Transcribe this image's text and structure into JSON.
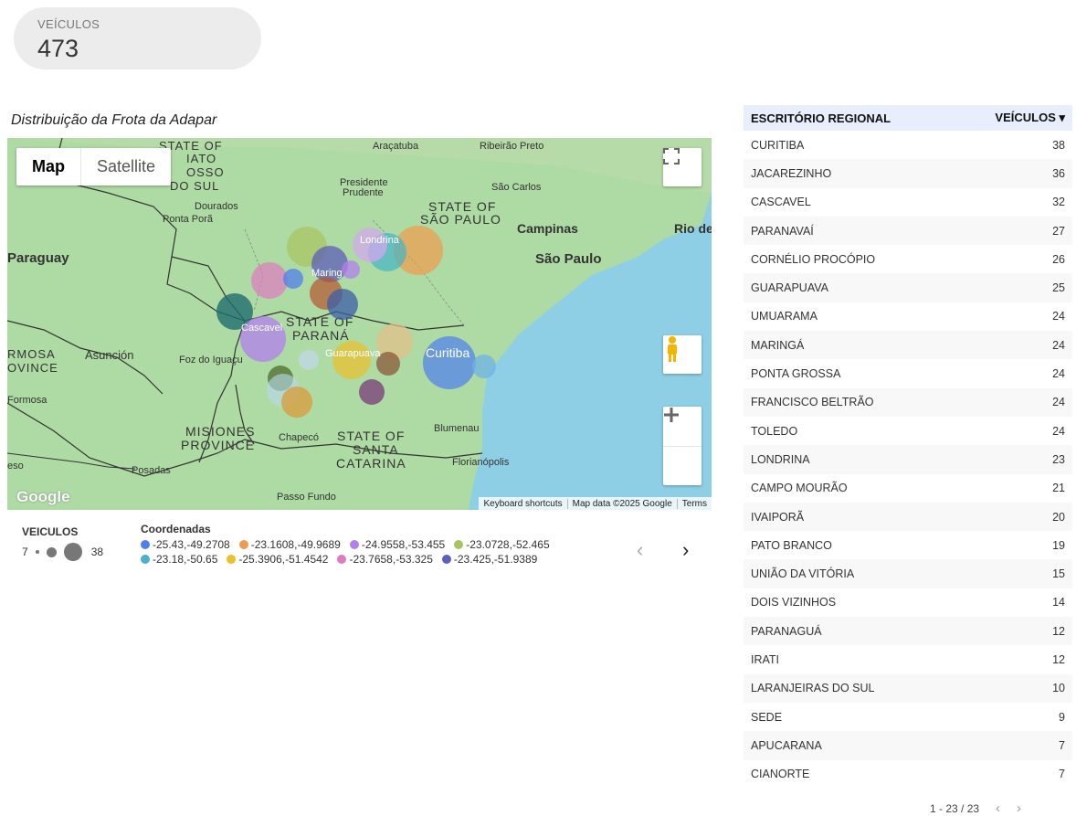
{
  "kpi": {
    "label": "VEÍCULOS",
    "value": "473"
  },
  "map": {
    "title": "Distribuição da Frota da Adapar",
    "map_btn": "Map",
    "satellite_btn": "Satellite",
    "attribution": {
      "shortcuts": "Keyboard shortcuts",
      "data": "Map data ©2025 Google",
      "terms": "Terms"
    },
    "google_logo": "Google",
    "places": {
      "paraguay": "Paraguay",
      "asuncion": "Asunción",
      "formosa": "Formosa",
      "formosa_prov_1": "RMOSA",
      "formosa_prov_2": "OVINCE",
      "ms_1": "STATE OF",
      "ms_2": "IATO",
      "ms_3": "OSSO",
      "ms_4": "DO SUL",
      "dourados": "Dourados",
      "ponta_pora": "Ponta Porã",
      "aracatuba": "Araçatuba",
      "ribeirao": "Ribeirão Preto",
      "pres_prudente_1": "Presidente",
      "pres_prudente_2": "Prudente",
      "sao_carlos": "São Carlos",
      "sp_1": "STATE OF",
      "sp_2": "SÃO PAULO",
      "campinas": "Campinas",
      "sao_paulo": "São Paulo",
      "rio": "Rio de",
      "londrina": "Londrina",
      "maringa": "Maring",
      "cascavel": "Cascavel",
      "guarapuava": "Guarapuava",
      "curitiba": "Curitiba",
      "pr_1": "STATE OF",
      "pr_2": "PARANÁ",
      "foz": "Foz do Iguaçu",
      "misiones_1": "MISIONES",
      "misiones_2": "PROVINCE",
      "posadas": "Posadas",
      "chapeco": "Chapecó",
      "sc_1": "STATE OF",
      "sc_2": "SANTA",
      "sc_3": "CATARINA",
      "blumenau": "Blumenau",
      "florianopolis": "Florianópolis",
      "passo_fundo": "Passo Fundo",
      "eso": "eso"
    }
  },
  "legend": {
    "size_title": "VEICULOS",
    "size_min": "7",
    "size_max": "38",
    "color_title": "Coordenadas",
    "items": [
      {
        "label": "-25.43,-49.2708",
        "color": "#4f7fee"
      },
      {
        "label": "-23.1608,-49.9689",
        "color": "#ef9b4b"
      },
      {
        "label": "-24.9558,-53.455",
        "color": "#b27fee"
      },
      {
        "label": "-23.0728,-52.465",
        "color": "#a8c55f"
      },
      {
        "label": "-23.18,-50.65",
        "color": "#46b3c8"
      },
      {
        "label": "-25.3906,-51.4542",
        "color": "#e8c030"
      },
      {
        "label": "-23.7658,-53.325",
        "color": "#e07bc0"
      },
      {
        "label": "-23.425,-51.9389",
        "color": "#5d5fb8"
      }
    ],
    "prev": "‹",
    "next": "›"
  },
  "table": {
    "col1": "ESCRITÓRIO REGIONAL",
    "col2": "VEÍCULOS ▾",
    "rows": [
      {
        "name": "CURITIBA",
        "value": "38"
      },
      {
        "name": "JACAREZINHO",
        "value": "36"
      },
      {
        "name": "CASCAVEL",
        "value": "32"
      },
      {
        "name": "PARANAVAÍ",
        "value": "27"
      },
      {
        "name": "CORNÉLIO PROCÓPIO",
        "value": "26"
      },
      {
        "name": "GUARAPUAVA",
        "value": "25"
      },
      {
        "name": "UMUARAMA",
        "value": "24"
      },
      {
        "name": "MARINGÁ",
        "value": "24"
      },
      {
        "name": "PONTA GROSSA",
        "value": "24"
      },
      {
        "name": "FRANCISCO BELTRÃO",
        "value": "24"
      },
      {
        "name": "TOLEDO",
        "value": "24"
      },
      {
        "name": "LONDRINA",
        "value": "23"
      },
      {
        "name": "CAMPO MOURÃO",
        "value": "21"
      },
      {
        "name": "IVAIPORÃ",
        "value": "20"
      },
      {
        "name": "PATO BRANCO",
        "value": "19"
      },
      {
        "name": "UNIÃO DA VITÓRIA",
        "value": "15"
      },
      {
        "name": "DOIS VIZINHOS",
        "value": "14"
      },
      {
        "name": "PARANAGUÁ",
        "value": "12"
      },
      {
        "name": "IRATI",
        "value": "12"
      },
      {
        "name": "LARANJEIRAS DO SUL",
        "value": "10"
      },
      {
        "name": "SEDE",
        "value": "9"
      },
      {
        "name": "APUCARANA",
        "value": "7"
      },
      {
        "name": "CIANORTE",
        "value": "7"
      }
    ],
    "pager": "1 - 23 / 23",
    "prev": "‹",
    "next": "›"
  }
}
